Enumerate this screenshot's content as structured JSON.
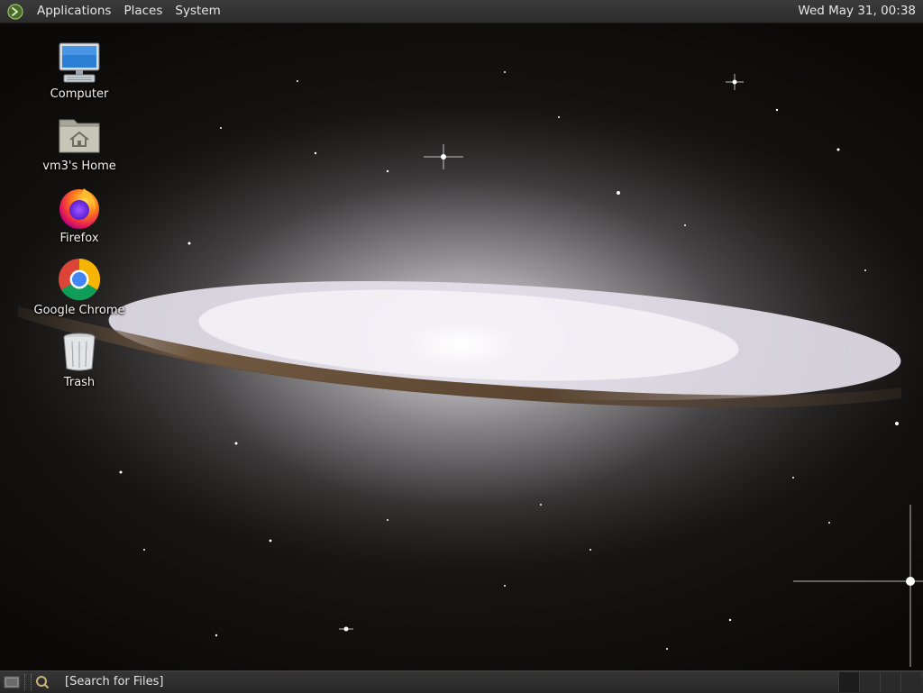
{
  "top_panel": {
    "menus": [
      "Applications",
      "Places",
      "System"
    ],
    "clock": "Wed May 31, 00:38",
    "logo_icon": "mate-logo-icon"
  },
  "desktop_icons": [
    {
      "label": "Computer",
      "icon": "computer-icon"
    },
    {
      "label": "vm3's Home",
      "icon": "home-folder-icon"
    },
    {
      "label": "Firefox",
      "icon": "firefox-icon"
    },
    {
      "label": "Google Chrome",
      "icon": "chrome-icon"
    },
    {
      "label": "Trash",
      "icon": "trash-icon"
    }
  ],
  "bottom_panel": {
    "search_text": "[Search for Files]",
    "workspace_count": 4
  },
  "colors": {
    "panel_bg": "#2f2f2f",
    "panel_text": "#e6e6e6",
    "desktop_label": "#f2f2f2"
  }
}
